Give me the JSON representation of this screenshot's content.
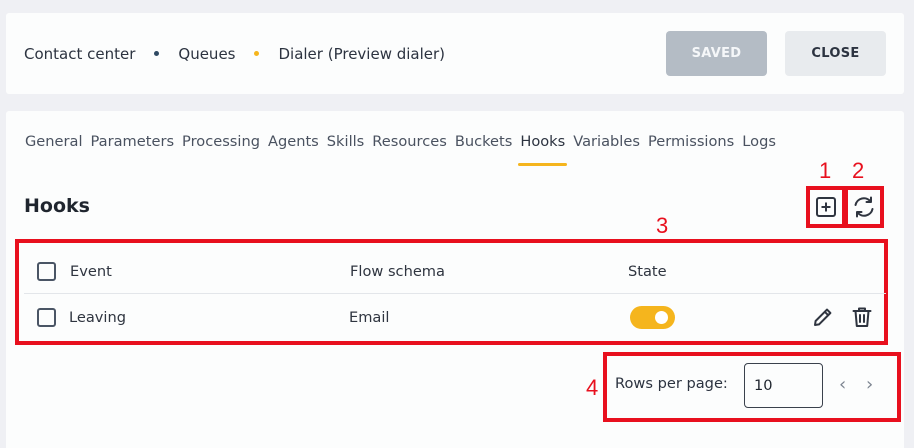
{
  "breadcrumb": {
    "items": [
      "Contact center",
      "Queues",
      "Dialer (Preview dialer)"
    ],
    "dot_colors": [
      "#2f4a63",
      "#f5b51d"
    ]
  },
  "header_actions": {
    "saved_label": "SAVED",
    "close_label": "CLOSE"
  },
  "tabs": [
    {
      "label": "General"
    },
    {
      "label": "Parameters"
    },
    {
      "label": "Processing"
    },
    {
      "label": "Agents"
    },
    {
      "label": "Skills"
    },
    {
      "label": "Resources"
    },
    {
      "label": "Buckets"
    },
    {
      "label": "Hooks",
      "active": true
    },
    {
      "label": "Variables"
    },
    {
      "label": "Permissions"
    },
    {
      "label": "Logs"
    }
  ],
  "section": {
    "title": "Hooks"
  },
  "table": {
    "headers": {
      "event": "Event",
      "flow_schema": "Flow schema",
      "state": "State"
    },
    "rows": [
      {
        "event": "Leaving",
        "flow_schema": "Email",
        "state_on": true
      }
    ]
  },
  "pagination": {
    "rows_per_page_label": "Rows per page:",
    "rows_per_page_value": "10"
  },
  "annotations": {
    "n1": "1",
    "n2": "2",
    "n3": "3",
    "n4": "4"
  },
  "colors": {
    "accent": "#f5b51d",
    "annotation": "#e8101e",
    "saved_button": "#b4bcc5"
  },
  "icons": {
    "add": "add-square-icon",
    "refresh": "refresh-icon",
    "edit": "pencil-icon",
    "delete": "trash-icon",
    "prev": "chevron-left-icon",
    "next": "chevron-right-icon"
  }
}
